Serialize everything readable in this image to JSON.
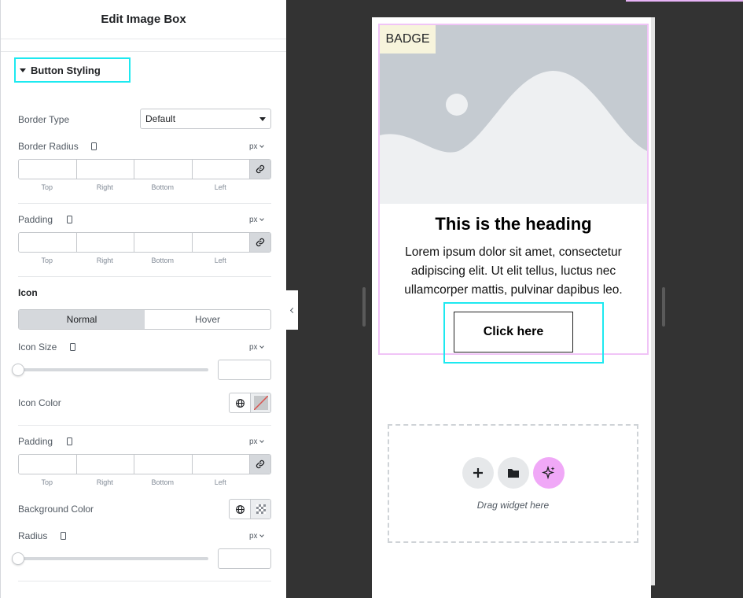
{
  "panel": {
    "title": "Edit Image Box",
    "section": "Button Styling",
    "border_type": {
      "label": "Border Type",
      "value": "Default"
    },
    "border_radius": {
      "label": "Border Radius",
      "unit": "px"
    },
    "padding": {
      "label": "Padding",
      "unit": "px"
    },
    "dims": {
      "top": "Top",
      "right": "Right",
      "bottom": "Bottom",
      "left": "Left"
    },
    "icon": {
      "heading": "Icon",
      "tab_normal": "Normal",
      "tab_hover": "Hover",
      "size": {
        "label": "Icon Size",
        "unit": "px"
      },
      "color_label": "Icon Color",
      "padding": {
        "label": "Padding",
        "unit": "px"
      },
      "bg_color_label": "Background Color",
      "radius": {
        "label": "Radius",
        "unit": "px"
      }
    }
  },
  "preview": {
    "badge": "BADGE",
    "heading": "This is the heading",
    "description": "Lorem ipsum dolor sit amet, consectetur adipiscing elit. Ut elit tellus, luctus nec ullamcorper mattis, pulvinar dapibus leo.",
    "button": "Click here",
    "drop_text": "Drag widget here"
  },
  "colors": {
    "highlight": "#1de9f0",
    "selection_border": "#f0c4f7",
    "ai_button": "#f0a8f7"
  }
}
